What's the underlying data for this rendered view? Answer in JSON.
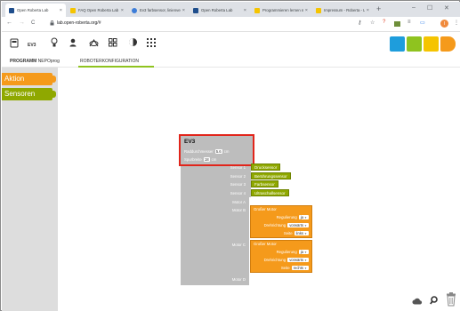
{
  "browser": {
    "tabs": [
      {
        "title": "Open Roberta Lab",
        "favicon_color": "#1f4e8c",
        "active": true
      },
      {
        "title": "FAQ Open Roberta Lab | Robo...",
        "favicon_color": "#f5c400",
        "active": false
      },
      {
        "title": "Ev3 farbsensor, linienver...",
        "favicon_color": "#3d7dd8",
        "active": false
      },
      {
        "title": "Open Roberta Lab",
        "favicon_color": "#1f4e8c",
        "active": false
      },
      {
        "title": "Programmieren lernen mit...",
        "favicon_color": "#f5c400",
        "active": false
      },
      {
        "title": "Impressum - Roberta - Le...",
        "favicon_color": "#f5c400",
        "active": false
      }
    ],
    "new_tab": "+",
    "close_tab": "×",
    "window": {
      "minimize": "–",
      "maximize": "☐",
      "close": "✕"
    },
    "nav": {
      "back": "←",
      "forward": "→",
      "reload": "C"
    },
    "url": "lab.open-roberta.org/#",
    "profile_initial": "I"
  },
  "app": {
    "toolbar_icons": [
      "home-icon",
      "ev3-robot-icon",
      "lightbulb-icon",
      "user-icon",
      "gallery-icon",
      "grid-icon",
      "language-icon",
      "apps-icon"
    ],
    "ev3_label": "EV3",
    "logo_colors": [
      "#1e9ddc",
      "#8fc31f",
      "#f5c400",
      "#f59a1b"
    ],
    "tabs": [
      {
        "bold": "PROGRAMM",
        "name": "NEPOprog",
        "active": false
      },
      {
        "bold": "",
        "name": "ROBOTERKONFIGURATION",
        "active": true
      }
    ],
    "categories": [
      {
        "label": "Aktion",
        "color": "#f59a1b"
      },
      {
        "label": "Sensoren",
        "color": "#8fa800"
      }
    ]
  },
  "config": {
    "ev3_block": {
      "title": "EV3",
      "wheel_label": "Raddurchmesser",
      "wheel_value": "5.6",
      "wheel_unit": "cm",
      "track_label": "Spurbreite",
      "track_value": "18",
      "track_unit": "cm"
    },
    "sensors": [
      {
        "port": "Sensor 1",
        "name": "Drucksensor"
      },
      {
        "port": "Sensor 2",
        "name": "Berührungssensor"
      },
      {
        "port": "Sensor 3",
        "name": "Farbsensor"
      },
      {
        "port": "Sensor 4",
        "name": "Ultraschallsensor"
      }
    ],
    "motor_a": "Motor A",
    "motor_b": {
      "port": "Motor B",
      "title": "Großer Motor",
      "reg_label": "Regulierung",
      "reg_value": "ja",
      "dir_label": "Drehrichtung",
      "dir_value": "vorwärts",
      "side_label": "Seite",
      "side_value": "links"
    },
    "motor_c": {
      "port": "Motor C",
      "title": "Großer Motor",
      "reg_label": "Regulierung",
      "reg_value": "ja",
      "dir_label": "Drehrichtung",
      "dir_value": "vorwärts",
      "side_label": "Seite",
      "side_value": "rechts"
    },
    "motor_d": "Motor D"
  },
  "workspace_controls": [
    "cloud-upload-icon",
    "zoom-icon",
    "trash-icon"
  ]
}
